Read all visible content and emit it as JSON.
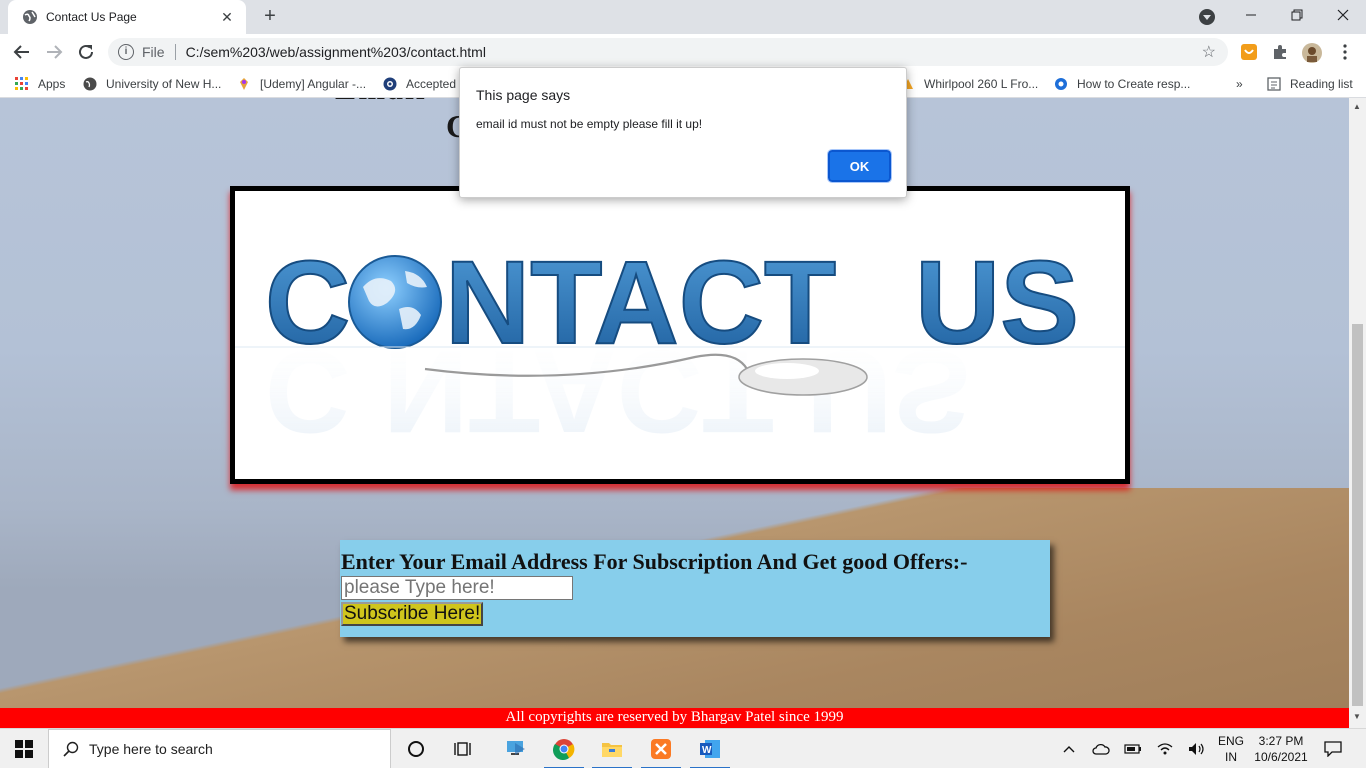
{
  "browser": {
    "tab_title": "Contact Us Page",
    "url_scheme": "File",
    "url": "C:/sem%203/web/assignment%203/contact.html",
    "new_tab_label": "+",
    "close_tab_label": "✕"
  },
  "bookmarks": {
    "items": [
      {
        "label": "Apps"
      },
      {
        "label": "University of New H..."
      },
      {
        "label": "[Udemy] Angular -..."
      },
      {
        "label": "Accepted"
      },
      {
        "label": "Whirlpool 260 L Fro..."
      },
      {
        "label": "How to Create resp..."
      }
    ],
    "overflow": "»",
    "reading_list": "Reading list"
  },
  "page": {
    "heading_fragment_1": "C",
    "banner": {
      "letters_left": "C",
      "letters_mid": "NTACT",
      "letters_right": "US"
    },
    "subscribe": {
      "heading": "Enter Your Email Address For Subscription And Get good Offers:-",
      "input_placeholder": "please Type here!",
      "button_label": "Subscribe Here!"
    },
    "footer": "All copyrights are reserved by Bhargav Patel since 1999"
  },
  "dialog": {
    "title": "This page says",
    "message": "email id must not be empty please fill it up!",
    "ok_label": "OK"
  },
  "taskbar": {
    "search_placeholder": "Type here to search",
    "language_top": "ENG",
    "language_bottom": "IN",
    "time": "3:27 PM",
    "date": "10/6/2021"
  },
  "colors": {
    "footer_bg": "#ff0000",
    "subscribe_bg": "#87ceeb",
    "subscribe_button": "#cfc51c",
    "dialog_button": "#1a73e8",
    "banner_text": "#2f7cc0"
  }
}
